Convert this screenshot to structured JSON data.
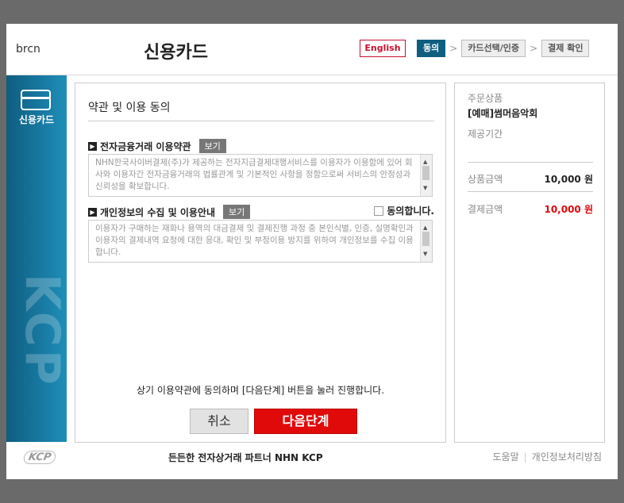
{
  "header": {
    "brand": "brcn",
    "title": "신용카드",
    "lang_button": "English",
    "steps": [
      {
        "label": "동의",
        "active": true
      },
      {
        "label": "카드선택/인증",
        "active": false
      },
      {
        "label": "결제 확인",
        "active": false
      }
    ]
  },
  "sidebar": {
    "payment_method": "신용카드"
  },
  "main": {
    "section_title": "약관 및 이용 동의",
    "term1": {
      "title": "전자금융거래 이용약관",
      "view_label": "보기",
      "text": "NHN한국사이버결제(주)가 제공하는 전자지급결제대행서비스를 이용자가 이용함에 있어 회사와 이용자간 전자금융거래의 법률관계 및 기본적인 사항을 정함으로써 서비스의 안정성과 신뢰성을 확보합니다."
    },
    "term2": {
      "title": "개인정보의 수집 및 이용안내",
      "view_label": "보기",
      "agree_label": "동의합니다.",
      "agree_checked": false,
      "text": "이용자가 구매하는 재화나 용역의 대금결제 및 결제진행 과정 중 본인식별, 인증, 실명확인과 이용자의 결제내역 요청에 대한 응대, 확인 및 부정이용 방지를 위하여 개인정보를 수집 이용합니다."
    },
    "notice": "상기 이용약관에 동의하며 [다음단계] 버튼을 눌러 진행합니다.",
    "cancel_label": "취소",
    "next_label": "다음단계"
  },
  "order": {
    "product_label": "주문상품",
    "product_name": "[예매]썸머음악회",
    "period_label": "제공기간",
    "price_label": "상품금액",
    "price_value": "10,000 원",
    "pay_label": "결제금액",
    "pay_value": "10,000 원"
  },
  "footer": {
    "logo": "KCP",
    "slogan": "든든한 전자상거래 파트너 NHN KCP",
    "help_link": "도움말",
    "privacy_link": "개인정보처리방침"
  },
  "colors": {
    "accent_blue": "#0e5e80",
    "accent_red": "#e00a0a"
  }
}
